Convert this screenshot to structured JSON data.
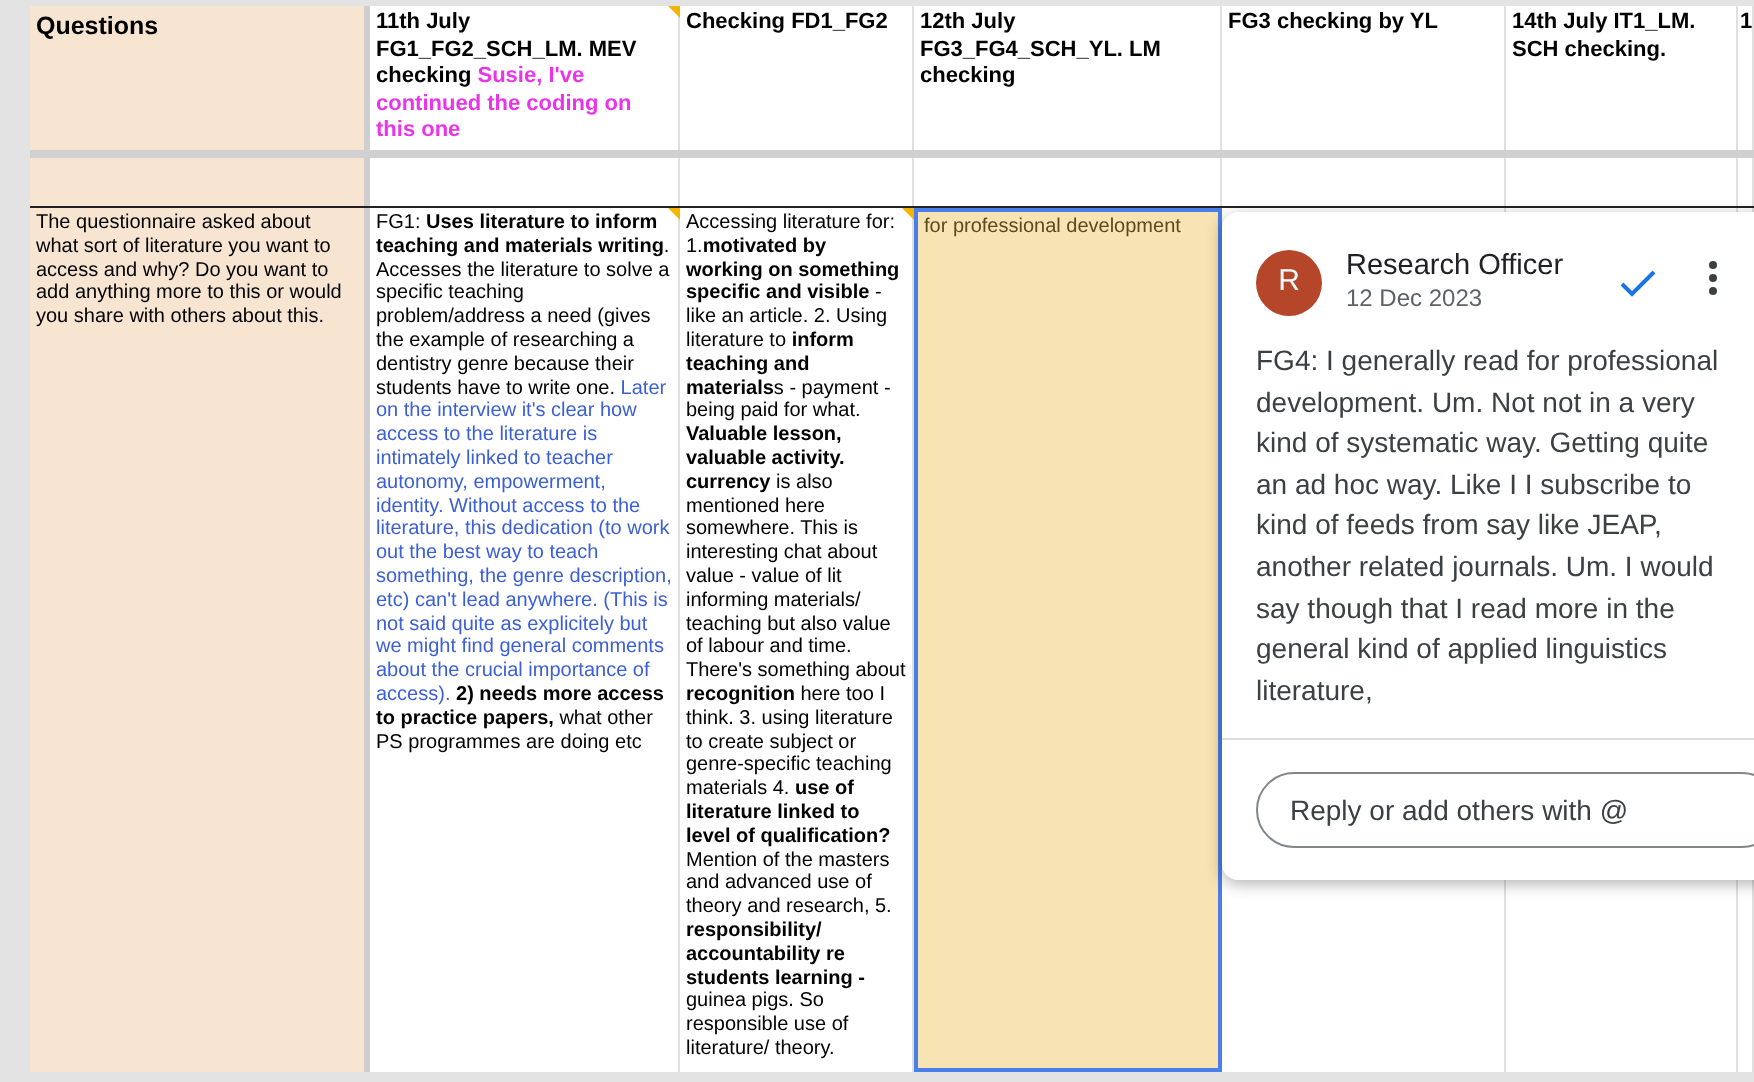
{
  "header_row": [
    {
      "segments": [
        {
          "text": "Questions"
        }
      ]
    },
    {
      "segments": [
        {
          "text": "11th July FG1_FG2_SCH_LM. MEV checking "
        },
        {
          "text": "Susie, I've continued the coding on this one",
          "color": "#e935e9"
        }
      ]
    },
    {
      "segments": [
        {
          "text": "Checking FD1_FG2"
        }
      ]
    },
    {
      "segments": [
        {
          "text": "12th July FG3_FG4_SCH_YL. LM checking"
        }
      ]
    },
    {
      "segments": [
        {
          "text": "FG3 checking by YL"
        }
      ]
    },
    {
      "segments": [
        {
          "text": "14th July IT1_LM. SCH checking."
        }
      ]
    },
    {
      "segments": [
        {
          "text": "1"
        }
      ]
    }
  ],
  "main_row": [
    {
      "selected": false,
      "segments": [
        {
          "text": "The questionnaire asked about what sort of literature you want to access and why? Do you want to add anything more to this or would you share with others about this."
        }
      ]
    },
    {
      "selected": false,
      "segments": [
        {
          "text": "FG1: **Uses literature to inform teaching and materials writing**. Accesses the literature to solve a specific teaching problem/address a need (gives the example of researching a dentistry genre because their students have to write one. "
        },
        {
          "text": "Later on the interview it's clear how access to the literature is intimately linked to teacher autonomy, empowerment, identity. Without access to the literature, this dedication (to work out the best way to teach something, the genre description, etc) can't lead anywhere. (This is not said quite as explicitely but we might find general comments about the crucial importance of access).",
          "color": "#3b5fd6"
        },
        {
          "text": " **2) needs more access to practice papers,** what other PS programmes are doing etc"
        }
      ]
    },
    {
      "selected": false,
      "segments": [
        {
          "text": "Accessing literature for: 1.**motivated by working on something specific and visible** - like an article. 2. Using literature to **inform teaching and materials**s - payment - being paid for what. **Valuable lesson, valuable activity. currency** is also mentioned here somewhere. This is interesting chat about value - value of lit informing materials/ teaching but also value of labour and time. There's something about **recognition** here too I think. 3. using literature to create subject or genre-specific teaching materials 4. **use of literature linked to level of qualification?** Mention of the masters and advanced use of theory and research, 5. **responsibility/ accountability re students learning -** guinea pigs. So responsible use of literature/ theory."
        }
      ]
    },
    {
      "selected": true,
      "segments": [
        {
          "text": "for professional development"
        }
      ]
    }
  ],
  "comment": {
    "initial": "R",
    "author": "Research Officer",
    "date": "12 Dec 2023",
    "body": "FG4: I generally read for professional development. Um. Not not in a very kind of systematic way. Getting quite an ad hoc way. Like I I subscribe to kind of feeds from say like JEAP, another related journals. Um. I would say though that I read more in the general kind of applied linguistics literature,",
    "reply_placeholder": "Reply or add others with @"
  }
}
